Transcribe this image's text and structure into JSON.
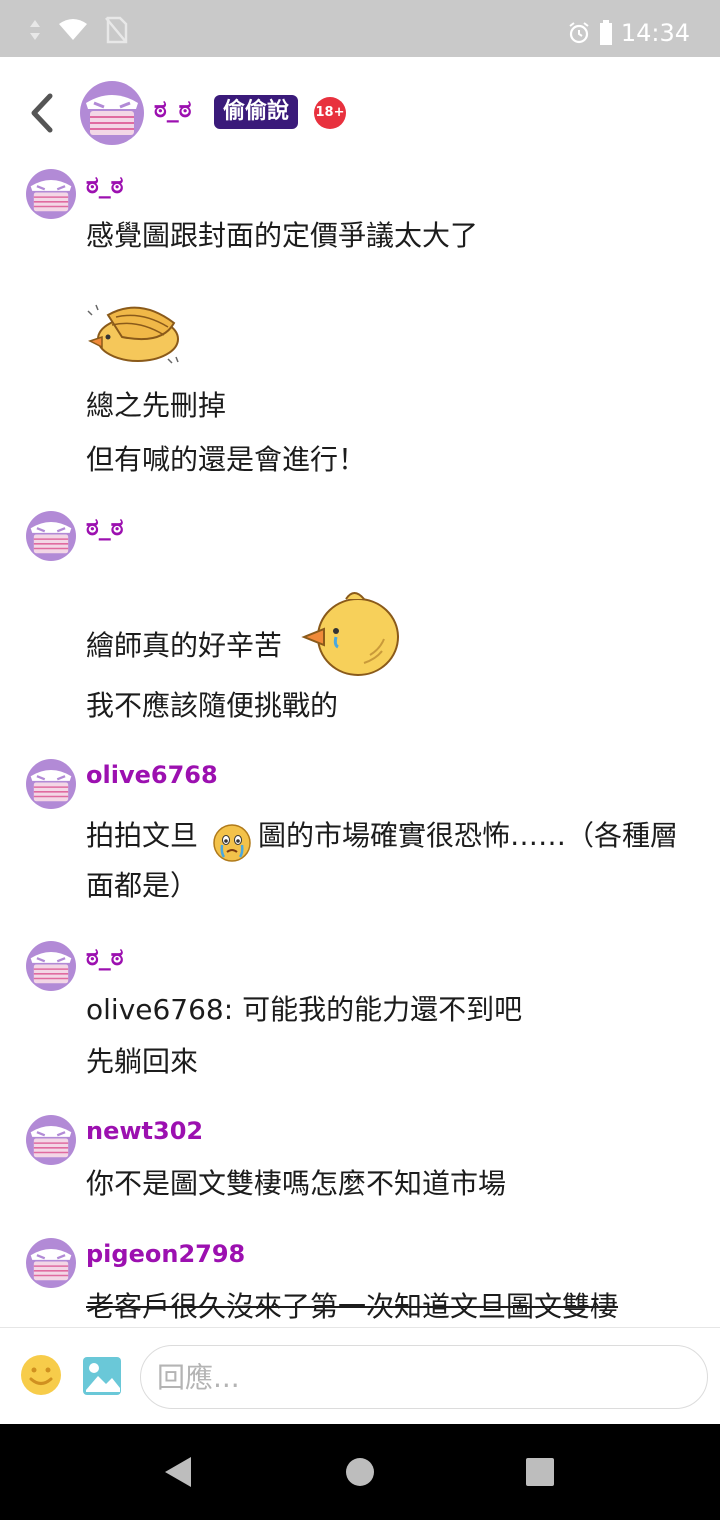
{
  "status_bar": {
    "time": "14:34",
    "icons": [
      "signal-icon",
      "wifi-icon",
      "no-sim-icon",
      "alarm-icon",
      "battery-icon"
    ]
  },
  "header": {
    "username": "ಠ_ಠ",
    "board_badge": "偷偷說",
    "age_badge": "18+",
    "back_icon": "chevron-left-icon"
  },
  "comments": [
    {
      "name": "ಠ_ಠ",
      "lines": [
        "感覺圖跟封面的定價爭議太大了",
        "總之先刪掉",
        "但有喊的還是會進行！"
      ],
      "sticker": "yellow-bird-sticker"
    },
    {
      "name": "ಠ_ಠ",
      "lines": [
        "繪師真的好辛苦",
        "我不應該隨便挑戰的"
      ],
      "sticker": "crying-chick-sticker"
    },
    {
      "name": "olive6768",
      "lines": [
        "拍拍文旦",
        "圖的市場確實很恐怖……（各種層",
        "面都是）"
      ],
      "emoji": "crying-face-emoji"
    },
    {
      "name": "ಠ_ಠ",
      "lines": [
        "olive6768: 可能我的能力還不到吧",
        "先躺回來"
      ]
    },
    {
      "name": "newt302",
      "lines": [
        "你不是圖文雙棲嗎怎麼不知道市場"
      ]
    },
    {
      "name": "pigeon2798",
      "lines": [
        "老客戶很久沒來了第一次知道文旦圖文雙棲"
      ],
      "strikethrough": true
    }
  ],
  "input_bar": {
    "placeholder": "回應...",
    "value": ""
  },
  "colors": {
    "username": "#9c10b0",
    "badge_bg": "#3a1a7a",
    "age_badge": "#e8313e",
    "avatar": "#b28ad6"
  },
  "nav": {
    "icons": [
      "back-triangle-icon",
      "home-circle-icon",
      "recents-square-icon"
    ]
  }
}
